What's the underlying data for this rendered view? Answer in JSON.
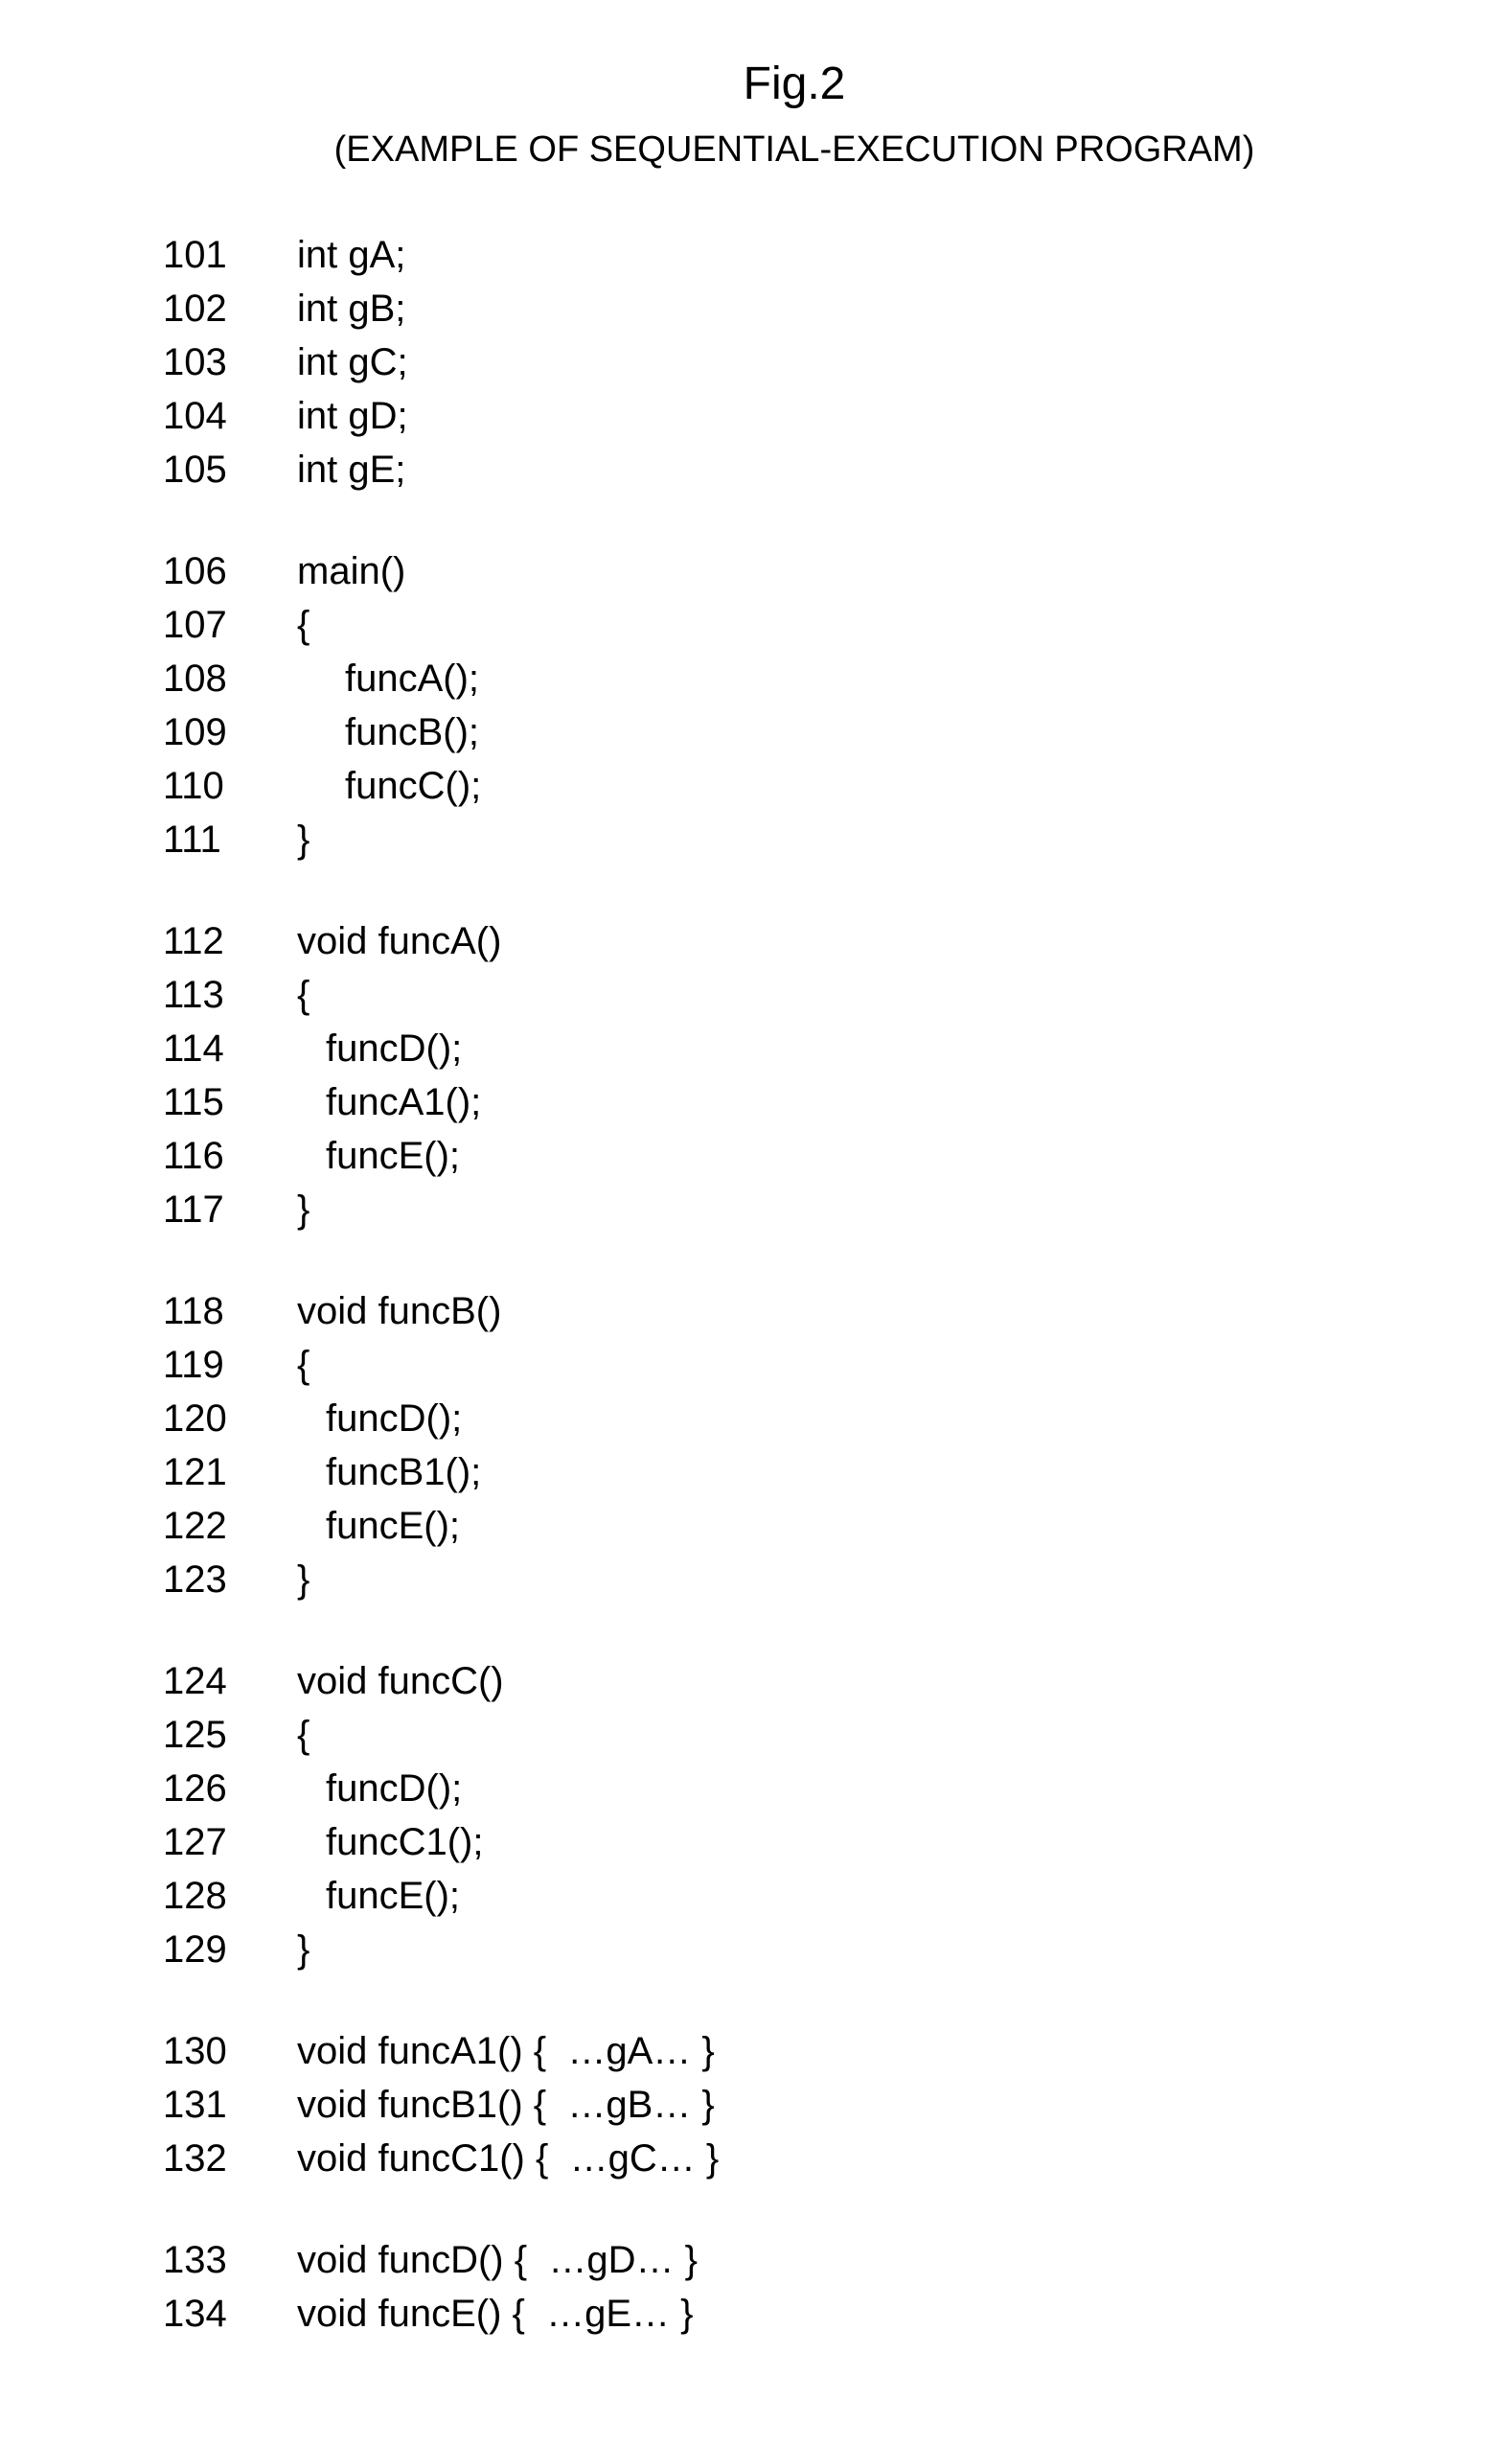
{
  "figure_title": "Fig.2",
  "subtitle": "(EXAMPLE OF SEQUENTIAL-EXECUTION PROGRAM)",
  "blocks": [
    {
      "lines": [
        {
          "num": "101",
          "text": "int gA;",
          "indent": 0
        },
        {
          "num": "102",
          "text": "int gB;",
          "indent": 0
        },
        {
          "num": "103",
          "text": "int gC;",
          "indent": 0
        },
        {
          "num": "104",
          "text": "int gD;",
          "indent": 0
        },
        {
          "num": "105",
          "text": "int gE;",
          "indent": 0
        }
      ]
    },
    {
      "lines": [
        {
          "num": "106",
          "text": "main()",
          "indent": 0
        },
        {
          "num": "107",
          "text": "{",
          "indent": 0
        },
        {
          "num": "108",
          "text": "funcA();",
          "indent": 1
        },
        {
          "num": "109",
          "text": "funcB();",
          "indent": 1
        },
        {
          "num": "110",
          "text": "funcC();",
          "indent": 1
        },
        {
          "num": "111",
          "text": "}",
          "indent": 0
        }
      ]
    },
    {
      "lines": [
        {
          "num": "112",
          "text": "void funcA()",
          "indent": 0
        },
        {
          "num": "113",
          "text": "{",
          "indent": 0
        },
        {
          "num": "114",
          "text": "funcD();",
          "indent": 2
        },
        {
          "num": "115",
          "text": "funcA1();",
          "indent": 2
        },
        {
          "num": "116",
          "text": "funcE();",
          "indent": 2
        },
        {
          "num": "117",
          "text": "}",
          "indent": 0
        }
      ]
    },
    {
      "lines": [
        {
          "num": "118",
          "text": "void funcB()",
          "indent": 0
        },
        {
          "num": "119",
          "text": "{",
          "indent": 0
        },
        {
          "num": "120",
          "text": "funcD();",
          "indent": 2
        },
        {
          "num": "121",
          "text": "funcB1();",
          "indent": 2
        },
        {
          "num": "122",
          "text": "funcE();",
          "indent": 2
        },
        {
          "num": "123",
          "text": "}",
          "indent": 0
        }
      ]
    },
    {
      "lines": [
        {
          "num": "124",
          "text": "void funcC()",
          "indent": 0
        },
        {
          "num": "125",
          "text": "{",
          "indent": 0
        },
        {
          "num": "126",
          "text": "funcD();",
          "indent": 2
        },
        {
          "num": "127",
          "text": "funcC1();",
          "indent": 2
        },
        {
          "num": "128",
          "text": "funcE();",
          "indent": 2
        },
        {
          "num": "129",
          "text": "}",
          "indent": 0
        }
      ]
    },
    {
      "lines": [
        {
          "num": "130",
          "text": "void funcA1() {  …gA… }",
          "indent": 0
        },
        {
          "num": "131",
          "text": "void funcB1() {  …gB… }",
          "indent": 0
        },
        {
          "num": "132",
          "text": "void funcC1() {  …gC… }",
          "indent": 0
        }
      ]
    },
    {
      "lines": [
        {
          "num": "133",
          "text": "void funcD() {  …gD… }",
          "indent": 0
        },
        {
          "num": "134",
          "text": "void funcE() {  …gE… }",
          "indent": 0
        }
      ]
    }
  ]
}
